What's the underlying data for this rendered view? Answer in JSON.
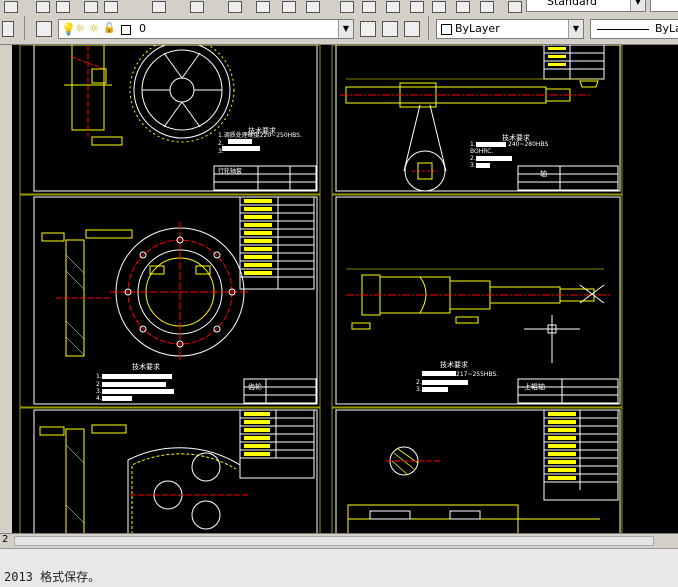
{
  "toolbar": {
    "style_combo": "Standard",
    "layer_value": "0",
    "color_combo": "ByLayer",
    "linetype_combo": "ByLay"
  },
  "sheets": {
    "s1_title": "技术要求",
    "s1_req1": "1.调质处理硬度220~250HBS.",
    "s1_req2": "2.",
    "s1_req3": "3.",
    "s1_name": "行轮轴套",
    "s2_title": "技术要求",
    "s2_req1": "1.",
    "s2_req1b": "240~280HBS",
    "s2_req1c": "BOHRC.",
    "s2_req2": "2.",
    "s2_req3": "3.",
    "s2_name": "轴",
    "s3_title": "技术要求",
    "s3_req1": "1.",
    "s3_req2": "2.",
    "s3_req3": "3.",
    "s3_req4": "4.",
    "s3_name": "齿轮",
    "s4_title": "技术要求",
    "s4_req1": "217~255HBS.",
    "s4_req2": "2.",
    "s4_req3": "3.",
    "s4_name": "上辊轴"
  },
  "status": {
    "tab_number": "2",
    "command_text": "2013 格式保存。"
  }
}
